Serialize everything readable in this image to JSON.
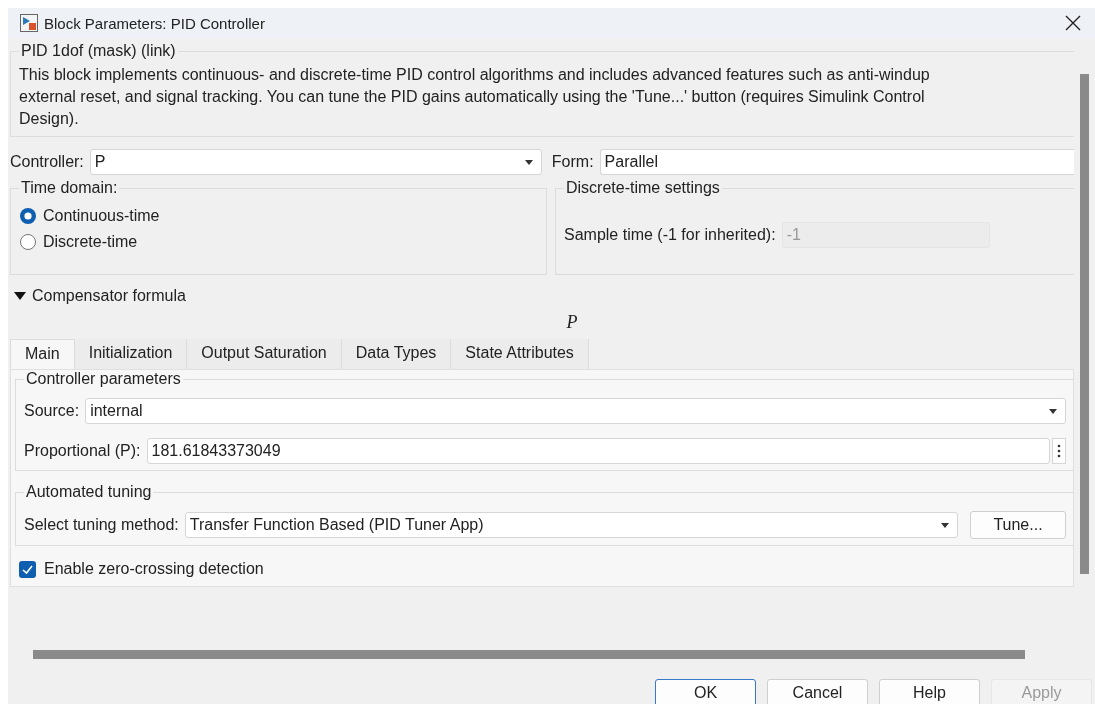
{
  "window": {
    "title": "Block Parameters: PID Controller"
  },
  "mask": {
    "title": "PID 1dof (mask) (link)",
    "description": "This block implements continuous- and discrete-time PID control algorithms and includes advanced features such as anti-windup\nexternal reset, and signal tracking. You can tune the PID gains automatically using the 'Tune...' button (requires Simulink Control\nDesign)."
  },
  "controller": {
    "label": "Controller:",
    "value": "P"
  },
  "form": {
    "label": "Form:",
    "value": "Parallel"
  },
  "time_domain": {
    "title": "Time domain:",
    "options": [
      {
        "label": "Continuous-time",
        "selected": true
      },
      {
        "label": "Discrete-time",
        "selected": false
      }
    ]
  },
  "discrete_settings": {
    "title": "Discrete-time settings",
    "sample_time": {
      "label": "Sample time (-1 for inherited):",
      "value": "-1",
      "disabled": true
    }
  },
  "compensator": {
    "label": "Compensator formula",
    "expanded": true,
    "formula": "P"
  },
  "tabs": [
    {
      "label": "Main",
      "selected": true
    },
    {
      "label": "Initialization",
      "selected": false
    },
    {
      "label": "Output Saturation",
      "selected": false
    },
    {
      "label": "Data Types",
      "selected": false
    },
    {
      "label": "State Attributes",
      "selected": false
    }
  ],
  "controller_parameters": {
    "title": "Controller parameters",
    "source": {
      "label": "Source:",
      "value": "internal"
    },
    "proportional": {
      "label": "Proportional (P):",
      "value": "181.61843373049"
    }
  },
  "automated_tuning": {
    "title": "Automated tuning",
    "method": {
      "label": "Select tuning method:",
      "value": "Transfer Function Based (PID Tuner App)"
    },
    "tune_button": "Tune..."
  },
  "zero_crossing": {
    "label": "Enable zero-crossing detection",
    "checked": true
  },
  "buttons": [
    {
      "label": "OK",
      "focused": true,
      "disabled": false
    },
    {
      "label": "Cancel",
      "focused": false,
      "disabled": false
    },
    {
      "label": "Help",
      "focused": false,
      "disabled": false
    },
    {
      "label": "Apply",
      "focused": false,
      "disabled": true
    }
  ]
}
